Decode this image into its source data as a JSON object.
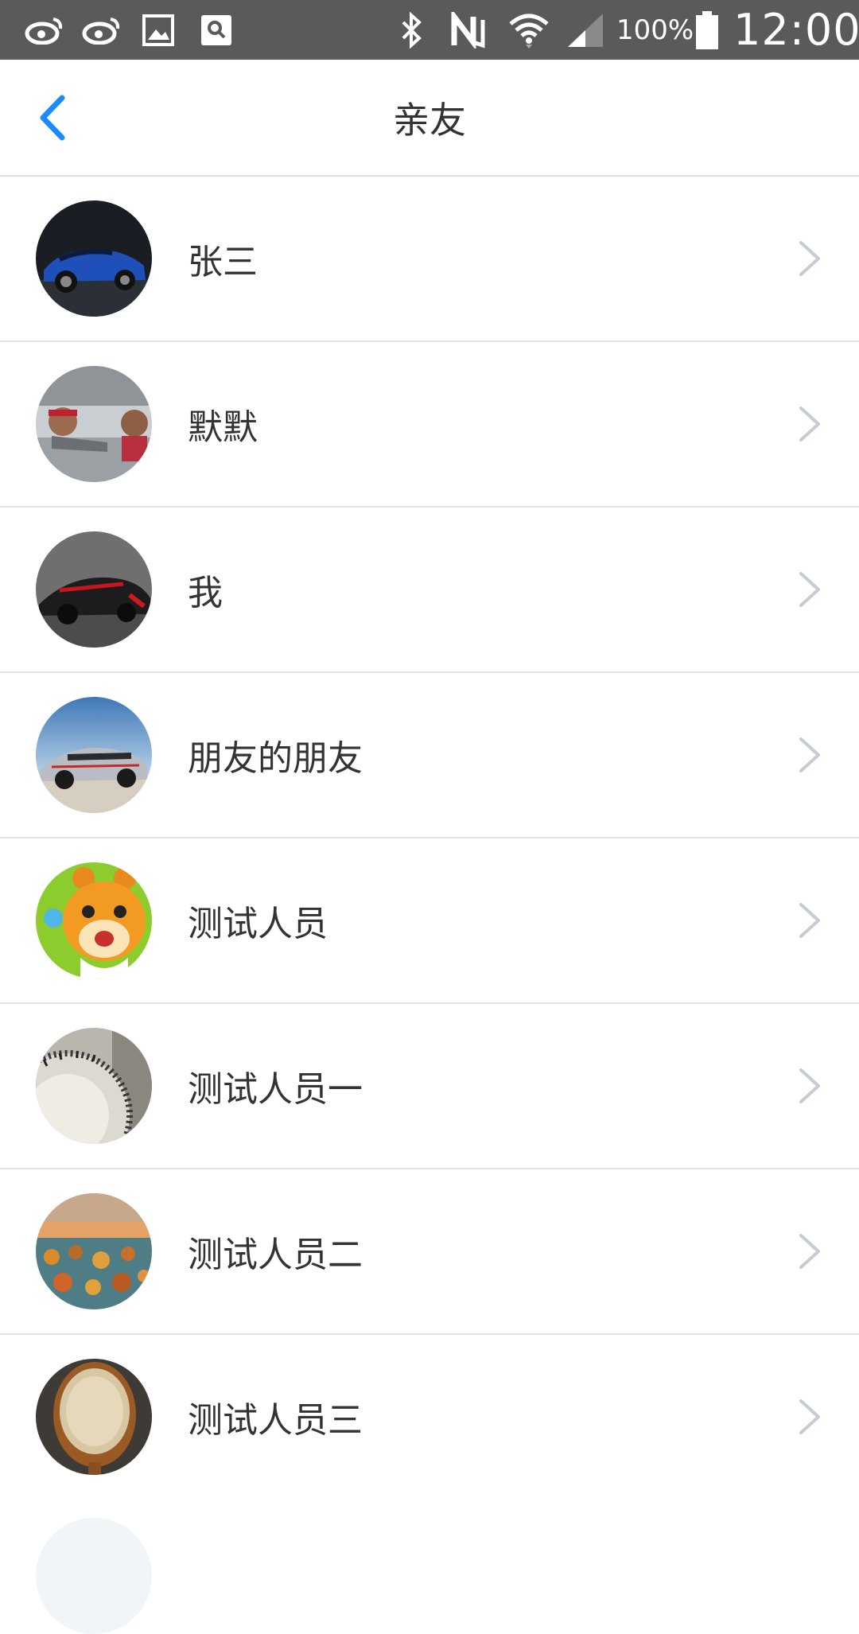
{
  "status_bar": {
    "battery_percent": "100%",
    "time": "12:00",
    "icons": [
      "weibo-icon",
      "weibo-icon",
      "gallery-icon",
      "search-app-icon",
      "bluetooth-icon",
      "nfc-icon",
      "wifi-icon",
      "signal-icon",
      "battery-icon"
    ]
  },
  "header": {
    "title": "亲友",
    "back_icon": "chevron-left-icon",
    "accent_color": "#1a8cff"
  },
  "contacts": [
    {
      "name": "张三",
      "avatar": "blue-sports-car-photo"
    },
    {
      "name": "默默",
      "avatar": "two-people-photo"
    },
    {
      "name": "我",
      "avatar": "race-car-photo"
    },
    {
      "name": "朋友的朋友",
      "avatar": "silver-roadster-photo"
    },
    {
      "name": "测试人员",
      "avatar": "cartoon-bear-photo"
    },
    {
      "name": "测试人员一",
      "avatar": "camera-dial-photo"
    },
    {
      "name": "测试人员二",
      "avatar": "landscape-photo"
    },
    {
      "name": "测试人员三",
      "avatar": "spoon-grain-photo"
    }
  ]
}
